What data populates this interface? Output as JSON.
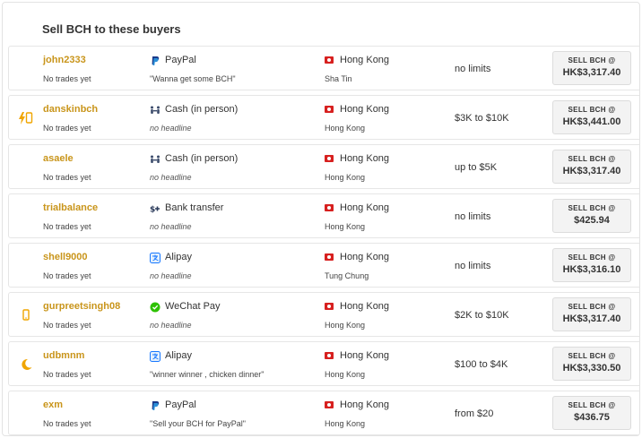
{
  "heading": "Sell BCH to these buyers",
  "colors": {
    "username": "#c9951b",
    "flag": "#d7201f",
    "badge": "#f0a500"
  },
  "rows": [
    {
      "username": "john2333",
      "trades": "No trades yet",
      "badge": "",
      "payment_method": "PayPal",
      "payment_icon": "paypal-icon",
      "headline": "\"Wanna get some BCH\"",
      "headline_empty": false,
      "country": "Hong Kong",
      "city": "Sha Tin",
      "limits": "no limits",
      "sell_label": "SELL BCH @",
      "price": "HK$3,317.40"
    },
    {
      "username": "danskinbch",
      "trades": "No trades yet",
      "badge": "lightning-phone",
      "payment_method": "Cash (in person)",
      "payment_icon": "people-icon",
      "headline": "no headline",
      "headline_empty": true,
      "country": "Hong Kong",
      "city": "Hong Kong",
      "limits": "$3K to $10K",
      "sell_label": "SELL BCH @",
      "price": "HK$3,441.00"
    },
    {
      "username": "asaele",
      "trades": "No trades yet",
      "badge": "",
      "payment_method": "Cash (in person)",
      "payment_icon": "people-icon",
      "headline": "no headline",
      "headline_empty": true,
      "country": "Hong Kong",
      "city": "Hong Kong",
      "limits": "up to $5K",
      "sell_label": "SELL BCH @",
      "price": "HK$3,317.40"
    },
    {
      "username": "trialbalance",
      "trades": "No trades yet",
      "badge": "",
      "payment_method": "Bank transfer",
      "payment_icon": "bank-transfer-icon",
      "headline": "no headline",
      "headline_empty": true,
      "country": "Hong Kong",
      "city": "Hong Kong",
      "limits": "no limits",
      "sell_label": "SELL BCH @",
      "price": "$425.94"
    },
    {
      "username": "shell9000",
      "trades": "No trades yet",
      "badge": "",
      "payment_method": "Alipay",
      "payment_icon": "alipay-icon",
      "headline": "no headline",
      "headline_empty": true,
      "country": "Hong Kong",
      "city": "Tung Chung",
      "limits": "no limits",
      "sell_label": "SELL BCH @",
      "price": "HK$3,316.10"
    },
    {
      "username": "gurpreetsingh08",
      "trades": "No trades yet",
      "badge": "phone",
      "payment_method": "WeChat Pay",
      "payment_icon": "wechat-icon",
      "headline": "no headline",
      "headline_empty": true,
      "country": "Hong Kong",
      "city": "Hong Kong",
      "limits": "$2K to $10K",
      "sell_label": "SELL BCH @",
      "price": "HK$3,317.40"
    },
    {
      "username": "udbmnm",
      "trades": "No trades yet",
      "badge": "moon",
      "payment_method": "Alipay",
      "payment_icon": "alipay-icon",
      "headline": "\"winner winner , chicken dinner\"",
      "headline_empty": false,
      "country": "Hong Kong",
      "city": "Hong Kong",
      "limits": "$100 to $4K",
      "sell_label": "SELL BCH @",
      "price": "HK$3,330.50"
    },
    {
      "username": "exm",
      "trades": "No trades yet",
      "badge": "",
      "payment_method": "PayPal",
      "payment_icon": "paypal-icon",
      "headline": "\"Sell your BCH for PayPal\"",
      "headline_empty": false,
      "country": "Hong Kong",
      "city": "Hong Kong",
      "limits": "from $20",
      "sell_label": "SELL BCH @",
      "price": "$436.75"
    }
  ]
}
